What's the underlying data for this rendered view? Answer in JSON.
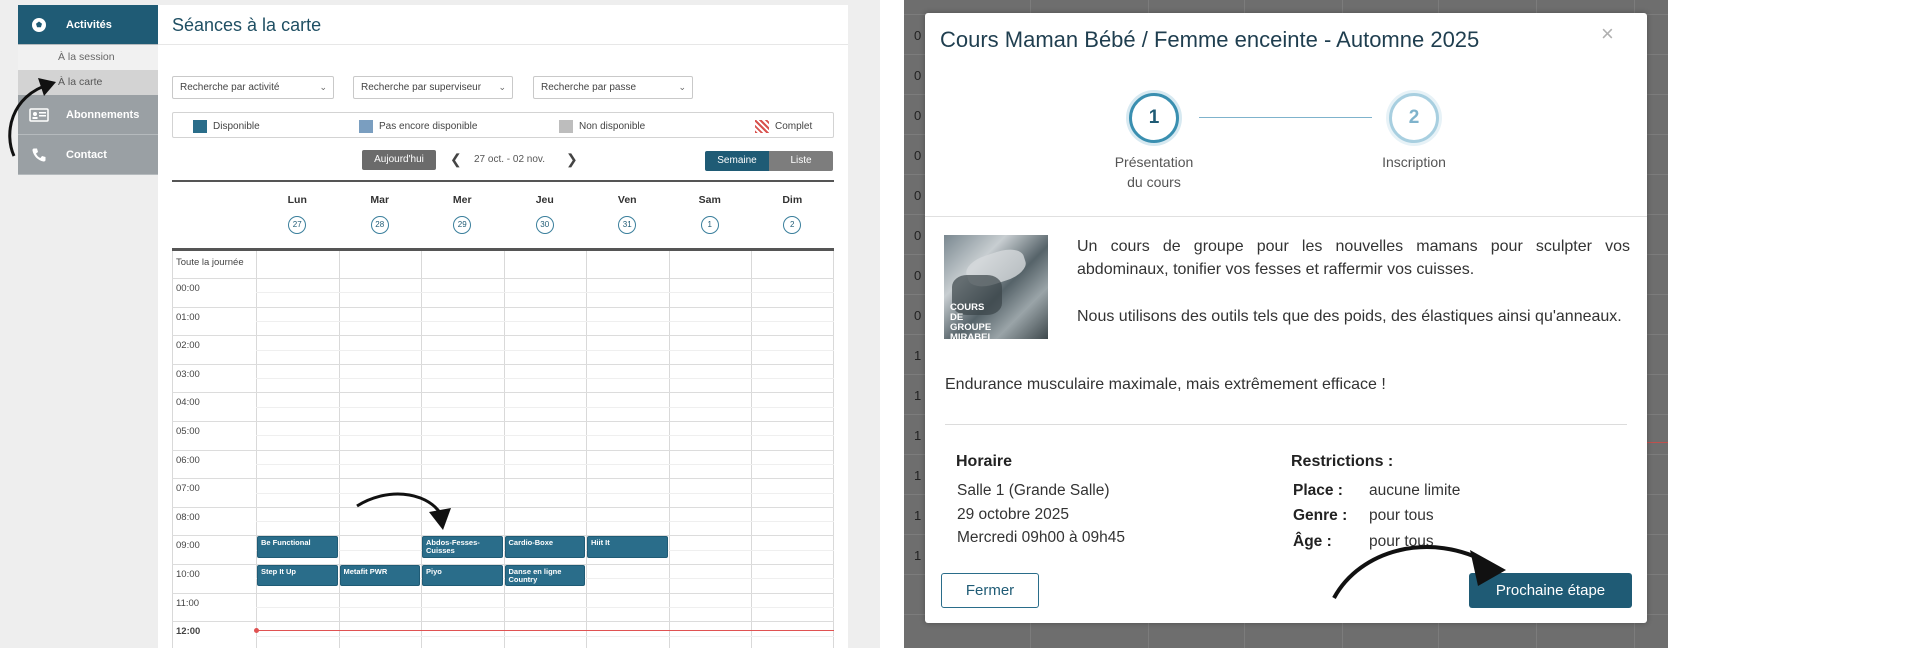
{
  "sidebar": {
    "items": [
      {
        "label": "Activités",
        "icon": "soccer-ball-icon"
      },
      {
        "label": "Abonnements",
        "icon": "id-card-icon"
      },
      {
        "label": "Contact",
        "icon": "phone-icon"
      }
    ],
    "sub_items": [
      "À la session",
      "À la carte"
    ]
  },
  "calendar": {
    "title": "Séances à la carte",
    "filters": [
      "Recherche par activité",
      "Recherche par superviseur",
      "Recherche par passe"
    ],
    "legend": [
      {
        "label": "Disponible",
        "color": "#2a6d8a"
      },
      {
        "label": "Pas encore disponible",
        "color": "#7a9ec0"
      },
      {
        "label": "Non disponible",
        "color": "#bdbdbd"
      },
      {
        "label": "Complet",
        "color": "#d9534f"
      }
    ],
    "today_label": "Aujourd'hui",
    "range": "27 oct. - 02 nov.",
    "view_week": "Semaine",
    "view_list": "Liste",
    "days": [
      {
        "name": "Lun",
        "num": "27"
      },
      {
        "name": "Mar",
        "num": "28"
      },
      {
        "name": "Mer",
        "num": "29"
      },
      {
        "name": "Jeu",
        "num": "30"
      },
      {
        "name": "Ven",
        "num": "31"
      },
      {
        "name": "Sam",
        "num": "1"
      },
      {
        "name": "Dim",
        "num": "2"
      }
    ],
    "allday_label": "Toute la journée",
    "hours": [
      "00:00",
      "01:00",
      "02:00",
      "03:00",
      "04:00",
      "05:00",
      "06:00",
      "07:00",
      "08:00",
      "09:00",
      "10:00",
      "11:00",
      "12:00"
    ],
    "events": [
      {
        "title": "Be Functional",
        "day": 0,
        "hour": 9
      },
      {
        "title": "Abdos-Fesses-Cuisses",
        "day": 2,
        "hour": 9
      },
      {
        "title": "Cardio-Boxe",
        "day": 3,
        "hour": 9
      },
      {
        "title": "Hiit It",
        "day": 4,
        "hour": 9
      },
      {
        "title": "Step It Up",
        "day": 0,
        "hour": 10
      },
      {
        "title": "Metafit PWR",
        "day": 1,
        "hour": 10
      },
      {
        "title": "Piyo",
        "day": 2,
        "hour": 10
      },
      {
        "title": "Danse en ligne Country",
        "day": 3,
        "hour": 10
      }
    ]
  },
  "background_numbers": [
    "0",
    "0",
    "0",
    "0",
    "0",
    "0",
    "0",
    "0",
    "1",
    "1",
    "1",
    "1",
    "1",
    "1"
  ],
  "modal": {
    "title": "Cours Maman Bébé / Femme enceinte - Automne 2025",
    "close_symbol": "×",
    "steps": [
      {
        "num": "1",
        "label_line1": "Présentation",
        "label_line2": "du cours"
      },
      {
        "num": "2",
        "label_line1": "Inscription",
        "label_line2": ""
      }
    ],
    "image_text": "COURS DE GROUPE MIRABEL",
    "description": [
      "Un cours de groupe pour les nouvelles mamans pour sculpter vos abdominaux, tonifier vos fesses et raffermir vos cuisses.",
      "Nous utilisons des outils tels que des poids, des élastiques ainsi qu'anneaux.",
      "Endurance musculaire maximale, mais extrêmement efficace !"
    ],
    "schedule": {
      "heading": "Horaire",
      "room": "Salle 1 (Grande Salle)",
      "date": "29 octobre 2025",
      "time": "Mercredi 09h00 à 09h45"
    },
    "restrictions": {
      "heading": "Restrictions :",
      "rows": [
        {
          "key": "Place :",
          "value": "aucune limite"
        },
        {
          "key": "Genre :",
          "value": "pour tous"
        },
        {
          "key": "Âge :",
          "value": "pour tous"
        }
      ]
    },
    "close_button": "Fermer",
    "next_button": "Prochaine étape"
  }
}
